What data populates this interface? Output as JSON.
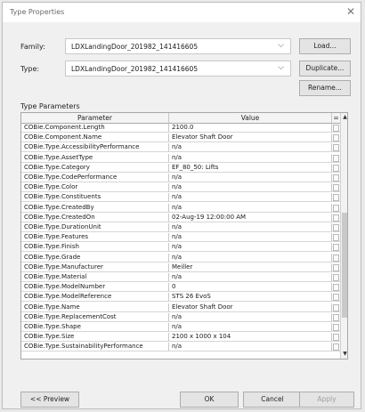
{
  "window": {
    "title": "Type Properties",
    "close_glyph": "✕"
  },
  "family": {
    "label": "Family:",
    "value": "LDXLandingDoor_201982_141416605"
  },
  "type": {
    "label": "Type:",
    "value": "LDXLandingDoor_201982_141416605"
  },
  "buttons": {
    "load": "Load...",
    "duplicate": "Duplicate...",
    "rename": "Rename..."
  },
  "section": {
    "type_parameters": "Type Parameters"
  },
  "grid": {
    "col_parameter": "Parameter",
    "col_value": "Value",
    "col_sort": "=",
    "rows": [
      {
        "parameter": "COBie.Component.Length",
        "value": "2100.0"
      },
      {
        "parameter": "COBie.Component.Name",
        "value": "Elevator Shaft Door"
      },
      {
        "parameter": "COBie.Type.AccessibilityPerformance",
        "value": "n/a"
      },
      {
        "parameter": "COBie.Type.AssetType",
        "value": "n/a"
      },
      {
        "parameter": "COBie.Type.Category",
        "value": "EF_80_50: Lifts"
      },
      {
        "parameter": "COBie.Type.CodePerformance",
        "value": "n/a"
      },
      {
        "parameter": "COBie.Type.Color",
        "value": "n/a"
      },
      {
        "parameter": "COBie.Type.Constituents",
        "value": "n/a"
      },
      {
        "parameter": "COBie.Type.CreatedBy",
        "value": "n/a"
      },
      {
        "parameter": "COBie.Type.CreatedOn",
        "value": "02-Aug-19 12:00:00 AM"
      },
      {
        "parameter": "COBie.Type.DurationUnit",
        "value": "n/a"
      },
      {
        "parameter": "COBie.Type.Features",
        "value": "n/a"
      },
      {
        "parameter": "COBie.Type.Finish",
        "value": "n/a"
      },
      {
        "parameter": "COBie.Type.Grade",
        "value": "n/a"
      },
      {
        "parameter": "COBie.Type.Manufacturer",
        "value": "Meiller"
      },
      {
        "parameter": "COBie.Type.Material",
        "value": "n/a"
      },
      {
        "parameter": "COBie.Type.ModelNumber",
        "value": "0"
      },
      {
        "parameter": "COBie.Type.ModelReference",
        "value": "STS 26 EvoS"
      },
      {
        "parameter": "COBie.Type.Name",
        "value": "Elevator Shaft Door"
      },
      {
        "parameter": "COBie.Type.ReplacementCost",
        "value": "n/a"
      },
      {
        "parameter": "COBie.Type.Shape",
        "value": "n/a"
      },
      {
        "parameter": "COBie.Type.Size",
        "value": "2100 x 1000 x 104"
      },
      {
        "parameter": "COBie.Type.SustainabilityPerformance",
        "value": "n/a"
      }
    ]
  },
  "footer": {
    "preview": "<< Preview",
    "ok": "OK",
    "cancel": "Cancel",
    "apply": "Apply"
  },
  "icons": {
    "dropdown": "chevron-down-icon",
    "scroll_up": "scroll-up-icon",
    "scroll_down": "scroll-down-icon"
  }
}
